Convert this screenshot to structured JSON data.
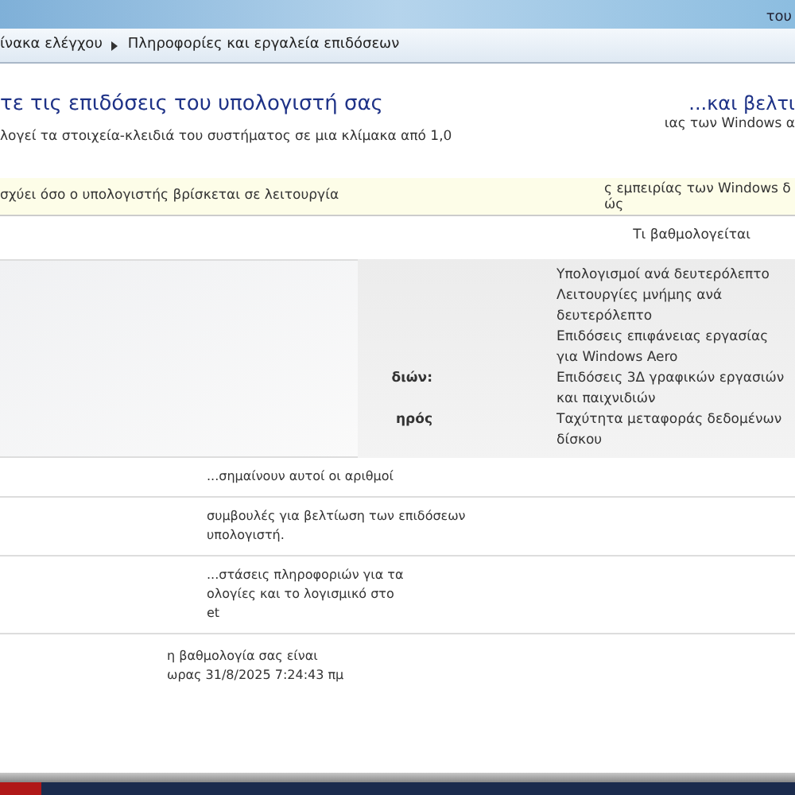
{
  "window": {
    "title_fragment": "του"
  },
  "breadcrumb": [
    {
      "label": "ίνακα ελέγχου"
    },
    {
      "label": "Πληροφορίες και εργαλεία επιδόσεων"
    }
  ],
  "heading": "τε τις επιδόσεις του υπολογιστή σας",
  "side_heading": "...και βελτι",
  "intro": "λογεί τα στοιχεία-κλειδιά του συστήματος σε μια κλίμακα από 1,0",
  "side_intro": "ιας των Windows α",
  "notice": {
    "text": "σχύει όσο ο υπολογιστής βρίσκεται σε λειτουργία",
    "side_lines": [
      "ς εμπειρίας των Windows δ",
      "ώς"
    ]
  },
  "table": {
    "column_header": "Τι βαθμολογείται",
    "rows": [
      {
        "description": "Υπολογισμοί ανά δευτερόλεπτο"
      },
      {
        "description": "Λειτουργίες μνήμης ανά δευτερόλεπτο"
      },
      {
        "description": "Επιδόσεις επιφάνειας εργασίας για Windows Aero"
      },
      {
        "label": "διών:",
        "description": "Επιδόσεις 3Δ γραφικών εργασιών και παιχνιδιών"
      },
      {
        "label": "ηρός",
        "description": "Ταχύτητα μεταφοράς δεδομένων δίσκου"
      }
    ]
  },
  "sections": [
    {
      "lines": [
        "...σημαίνουν αυτοί οι αριθμοί"
      ]
    },
    {
      "lines": [
        "συμβουλές για βελτίωση των επιδόσεων",
        "υπολογιστή."
      ]
    },
    {
      "lines": [
        "...στάσεις πληροφοριών για τα",
        "ολογίες και το λογισμικό στο",
        "et"
      ]
    }
  ],
  "footer": {
    "score_line": "η βαθμολογία σας είναι",
    "date_line": "ωρας 31/8/2025 7:24:43 πμ"
  }
}
